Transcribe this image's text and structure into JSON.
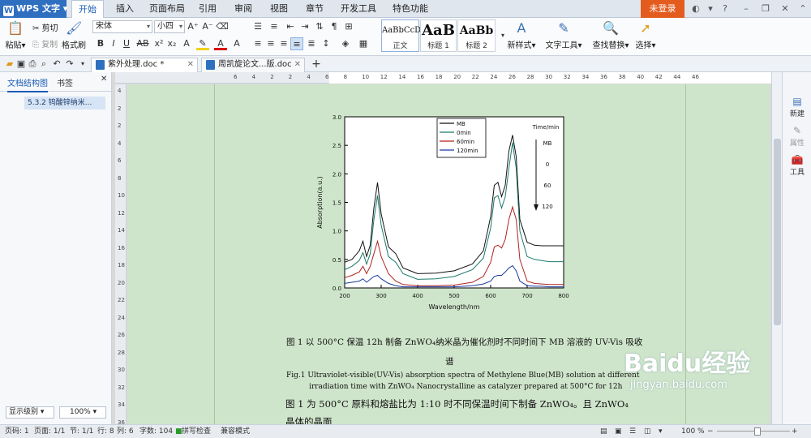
{
  "app": {
    "title": "WPS 文字",
    "login": "未登录"
  },
  "menu_tabs": [
    "开始",
    "插入",
    "页面布局",
    "引用",
    "审阅",
    "视图",
    "章节",
    "开发工具",
    "特色功能"
  ],
  "ribbon": {
    "paste": "粘贴",
    "cut": "剪切",
    "copy": "复制",
    "format_painter": "格式刷",
    "font_name": "宋体",
    "font_size": "小四",
    "styles": [
      {
        "sample": "AaBbCcD",
        "name": "正文"
      },
      {
        "sample": "AaB",
        "name": "标题 1"
      },
      {
        "sample": "AaBb",
        "name": "标题 2"
      }
    ],
    "new_style": "新样式",
    "text_tools": "文字工具",
    "find_replace": "查找替换",
    "select": "选择"
  },
  "doc_tabs": [
    {
      "label": "紫外处理.doc *",
      "active": true
    },
    {
      "label": "周凯旋论文...版.doc",
      "active": false
    }
  ],
  "nav": {
    "tab_outline": "文档结构图",
    "tab_bookmark": "书签",
    "item": "5.3.2 钨酸锌纳米...",
    "level": "显示级别",
    "zoom": "100%"
  },
  "ruler_h": [
    "6",
    "4",
    "2",
    "2",
    "4",
    "6",
    "8",
    "10",
    "12",
    "14",
    "16",
    "18",
    "20",
    "22",
    "24",
    "26",
    "28",
    "30",
    "32",
    "34",
    "36",
    "38",
    "40",
    "42",
    "44",
    "46"
  ],
  "ruler_v": [
    "4",
    "2",
    "2",
    "4",
    "6",
    "8",
    "10",
    "12",
    "14",
    "16",
    "18",
    "20",
    "22",
    "24",
    "26",
    "28",
    "30",
    "32",
    "34",
    "36"
  ],
  "right_pane": {
    "new": "新建",
    "props": "属性",
    "tools": "工具"
  },
  "document": {
    "caption_cn_1": "图 1 以 500°C 保温 12h 制备 ZnWO₄纳米晶为催化剂时不同时间下 MB 溶液的 UV-Vis 吸收",
    "caption_cn_2": "谱",
    "caption_en_1": "Fig.1 Ultraviolet-visible(UV-Vis) absorption spectra of Methylene Blue(MB) solution at different",
    "caption_en_2": "irradiation time with ZnWO₄ Nanocrystalline as catalyzer prepared at 500°C for 12h",
    "body_1": "图 1 为 500°C 原料和熔盐比为 1:10 时不同保温时间下制备 ZnWO₄。且 ZnWO₄",
    "body_2": "晶体的晶面"
  },
  "chart_data": {
    "type": "line",
    "xlabel": "Wavelength/nm",
    "ylabel": "Absorption(a.u.)",
    "xlim": [
      200,
      800
    ],
    "ylim": [
      0.0,
      3.0
    ],
    "xticks": [
      "200",
      "300",
      "400",
      "500",
      "600",
      "700",
      "800"
    ],
    "yticks": [
      "0.0",
      "0.5",
      "1.0",
      "1.5",
      "2.0",
      "2.5",
      "3.0"
    ],
    "legend_position": "top-center",
    "annotation": {
      "title": "Time/min",
      "labels": [
        "MB",
        "0",
        "60",
        "120"
      ]
    },
    "x": [
      200,
      220,
      240,
      250,
      260,
      270,
      280,
      290,
      300,
      320,
      340,
      360,
      400,
      450,
      500,
      550,
      580,
      600,
      610,
      620,
      630,
      640,
      650,
      660,
      670,
      680,
      700,
      720,
      740,
      760,
      780,
      800
    ],
    "series": [
      {
        "name": "MB",
        "color": "#111111",
        "values": [
          0.45,
          0.5,
          0.65,
          0.82,
          0.55,
          0.75,
          1.4,
          1.85,
          1.3,
          0.72,
          0.6,
          0.35,
          0.25,
          0.26,
          0.3,
          0.42,
          0.65,
          1.25,
          1.8,
          1.85,
          1.6,
          1.8,
          2.4,
          2.68,
          2.3,
          1.2,
          0.8,
          0.75,
          0.74,
          0.74,
          0.74,
          0.74
        ]
      },
      {
        "name": "0min",
        "color": "#1a7a6a",
        "values": [
          0.32,
          0.38,
          0.48,
          0.62,
          0.42,
          0.6,
          1.2,
          1.62,
          1.1,
          0.55,
          0.45,
          0.25,
          0.15,
          0.16,
          0.2,
          0.32,
          0.52,
          1.05,
          1.58,
          1.62,
          1.4,
          1.6,
          2.1,
          2.55,
          2.1,
          1.0,
          0.55,
          0.5,
          0.48,
          0.46,
          0.46,
          0.46
        ]
      },
      {
        "name": "60min",
        "color": "#b22222",
        "values": [
          0.18,
          0.22,
          0.28,
          0.38,
          0.25,
          0.38,
          0.6,
          0.82,
          0.55,
          0.25,
          0.12,
          0.06,
          0.04,
          0.04,
          0.05,
          0.1,
          0.2,
          0.45,
          0.72,
          0.75,
          0.7,
          0.85,
          1.2,
          1.42,
          1.2,
          0.5,
          0.12,
          0.08,
          0.07,
          0.06,
          0.06,
          0.06
        ]
      },
      {
        "name": "120min",
        "color": "#1a3aa0",
        "values": [
          0.08,
          0.1,
          0.12,
          0.16,
          0.1,
          0.15,
          0.2,
          0.22,
          0.16,
          0.08,
          0.04,
          0.02,
          0.02,
          0.02,
          0.02,
          0.04,
          0.07,
          0.12,
          0.2,
          0.22,
          0.22,
          0.28,
          0.35,
          0.39,
          0.3,
          0.12,
          0.04,
          0.03,
          0.03,
          0.02,
          0.02,
          0.02
        ]
      }
    ]
  },
  "status": {
    "page_no": "页码: 1",
    "pages": "页面: 1/1",
    "section": "节: 1/1",
    "row": "行: 8",
    "col": "列: 6",
    "words": "字数: 104",
    "spell": "拼写检查",
    "compat": "兼容模式",
    "zoom": "100 %"
  },
  "watermark": {
    "brand": "Baidu经验",
    "url": "jingyan.baidu.com"
  }
}
